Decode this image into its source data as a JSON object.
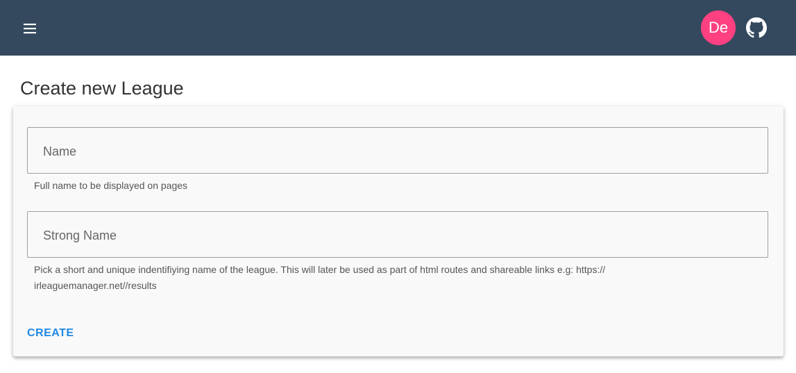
{
  "appbar": {
    "menu_icon": "hamburger-menu-icon",
    "avatar_text": "De",
    "github_icon": "github-icon",
    "colors": {
      "background": "#34495e",
      "avatar": "#ff4081"
    }
  },
  "page": {
    "title": "Create new League"
  },
  "form": {
    "name_field": {
      "label": "Name",
      "value": "",
      "hint": "Full name to be displayed on pages"
    },
    "strong_name_field": {
      "label": "Strong Name",
      "value": "",
      "hint": "Pick a short and unique indentifiying name of the league. This will later be used as part of html routes and shareable links e.g: https:// irleaguemanager.net//results"
    },
    "create_label": "CREATE",
    "accent_color": "#1e88e5"
  }
}
